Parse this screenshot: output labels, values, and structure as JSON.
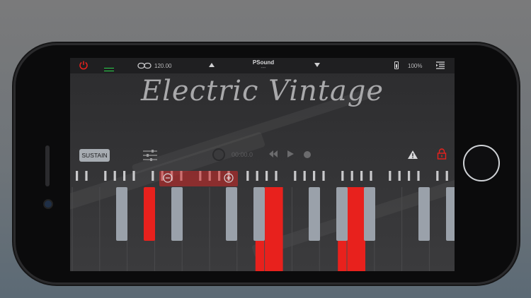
{
  "status_bar": {
    "tempo": "120.00",
    "sound_name": "PSound",
    "sound_sub": "---",
    "battery_percent": "100%"
  },
  "app": {
    "title": "Electric Vintage"
  },
  "controls": {
    "sustain_label": "SUSTAIN",
    "time_display": "00:00.0"
  },
  "keyboard": {
    "pressed_keys_color": "#e8211d",
    "black_key_color": "#9aa1aa",
    "white_key_pressed": [
      "C-oct1-E",
      "C-oct2-C"
    ],
    "black_key_pressed": [
      "oct1-Db"
    ]
  },
  "colors": {
    "accent_red": "#e8211d",
    "green_indicator": "#2bd44b"
  },
  "icons": [
    "power-icon",
    "link-icon",
    "up-arrow-icon",
    "down-arrow-icon",
    "battery-icon",
    "menu-icon",
    "mixer-icon",
    "record-icon",
    "rewind-icon",
    "play-icon",
    "stop-dot-icon",
    "warning-icon",
    "lock-icon",
    "zoom-minus-icon",
    "zoom-plus-icon"
  ]
}
